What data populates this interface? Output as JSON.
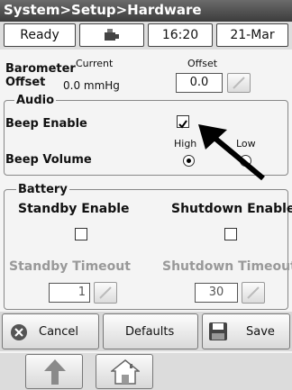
{
  "title": "System>Setup>Hardware",
  "status": {
    "state": "Ready",
    "time": "16:20",
    "date": "21-Mar"
  },
  "barometer": {
    "label_line1": "Barometer",
    "label_line2": "Offset",
    "current_header": "Current",
    "current_value": "0.0 mmHg",
    "offset_header": "Offset",
    "offset_value": "0.0"
  },
  "audio": {
    "legend": "Audio",
    "beep_enable_label": "Beep Enable",
    "beep_enable_checked": true,
    "beep_volume_label": "Beep Volume",
    "high_label": "High",
    "low_label": "Low",
    "selected": "High"
  },
  "battery": {
    "legend": "Battery",
    "standby_enable_label": "Standby Enable",
    "shutdown_enable_label": "Shutdown Enable",
    "standby_enable_checked": false,
    "shutdown_enable_checked": false,
    "standby_timeout_label": "Standby Timeout",
    "shutdown_timeout_label": "Shutdown Timeout",
    "standby_timeout_value": "1",
    "shutdown_timeout_value": "30"
  },
  "actions": {
    "cancel": "Cancel",
    "defaults": "Defaults",
    "save": "Save"
  },
  "colors": {
    "title_bg": "#4a4a4a",
    "cancel_icon": "#555555",
    "arrow_icon": "#8a8a8a"
  }
}
